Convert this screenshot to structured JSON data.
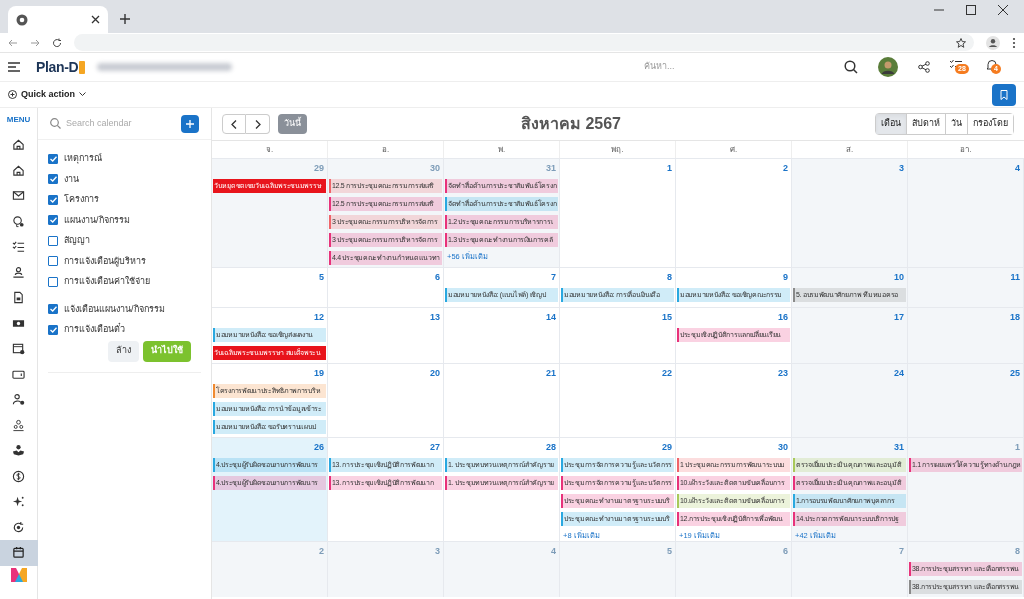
{
  "app": {
    "logo": "Plan-D",
    "search_placeholder": "ค้นหา...",
    "task_badge": "28",
    "notification_badge": "4",
    "quick_action": "Quick action"
  },
  "nav_rail": {
    "label": "MENU",
    "items": [
      {
        "selected": false
      },
      {
        "selected": false
      },
      {
        "selected": false
      },
      {
        "selected": false
      },
      {
        "selected": false
      },
      {
        "selected": false
      },
      {
        "selected": false
      },
      {
        "selected": false
      },
      {
        "selected": false
      },
      {
        "selected": false
      },
      {
        "selected": false
      },
      {
        "selected": false
      },
      {
        "selected": false
      },
      {
        "selected": false
      },
      {
        "selected": false
      },
      {
        "selected": false
      },
      {
        "selected": true
      }
    ]
  },
  "filter_panel": {
    "search_placeholder": "Search calendar",
    "groups": [
      [
        {
          "label": "เหตุการณ์",
          "checked": true
        },
        {
          "label": "งาน",
          "checked": true
        },
        {
          "label": "โครงการ",
          "checked": true
        },
        {
          "label": "แผนงาน/กิจกรรม",
          "checked": true
        },
        {
          "label": "สัญญา",
          "checked": false
        },
        {
          "label": "การแจ้งเตือนผู้บริหาร",
          "checked": false
        },
        {
          "label": "การแจ้งเตือนค่าใช้จ่าย",
          "checked": false
        }
      ],
      [
        {
          "label": "แจ้งเตือนแผนงาน/กิจกรรม",
          "checked": true
        },
        {
          "label": "การแจ้งเตือนตั๋ว",
          "checked": true
        }
      ]
    ],
    "clear_button": "ล้าง",
    "apply_button": "นำไปใช้"
  },
  "calendar": {
    "today_button": "วันนี้",
    "title": "สิงหาคม 2567",
    "views": [
      {
        "label": "เดือน",
        "selected": true
      },
      {
        "label": "สัปดาห์",
        "selected": false
      },
      {
        "label": "วัน",
        "selected": false
      },
      {
        "label": "กรองโดย",
        "selected": false
      }
    ],
    "weekdays": [
      "จ.",
      "อ.",
      "พ.",
      "พฤ.",
      "ศ.",
      "ส.",
      "อา."
    ],
    "weeks": [
      {
        "days": [
          {
            "day": "29",
            "outside": true,
            "today": false,
            "events": [
              {
                "kind": "holiday",
                "color": "#e8141c",
                "text": "วันหยุดชดเชยวันเฉลิมพระชนมพรรษ"
              }
            ]
          },
          {
            "day": "30",
            "outside": true,
            "today": false,
            "events": [
              {
                "kind": "event",
                "color": "#f0646a",
                "text": "12.5 การประชุมคณะกรรมการส่งเสริ"
              },
              {
                "kind": "event",
                "color": "#e8327a",
                "text": "12.5 การประชุมคณะกรรมการส่งเสริ"
              },
              {
                "kind": "event",
                "color": "#f0646a",
                "text": "3 ประชุมคณะกรรมการบริหารจัดการ"
              },
              {
                "kind": "event",
                "color": "#e8327a",
                "text": "3 ประชุมคณะกรรมการบริหารจัดการ"
              },
              {
                "kind": "event",
                "color": "#e8327a",
                "text": "4.4 ประชุมคณะทำงานกำหนดแนวทา"
              }
            ]
          },
          {
            "day": "31",
            "outside": true,
            "today": false,
            "events": [
              {
                "kind": "event",
                "color": "#e8327a",
                "text": "จัดทำสื่อด้านการประชาสัมพันธ์โครงก"
              },
              {
                "kind": "event",
                "color": "#29a8e0",
                "text": "จัดทำสื่อด้านการประชาสัมพันธ์โครงก"
              },
              {
                "kind": "event",
                "color": "#e8327a",
                "text": "1.2 ประชุมคณะกรรมการบริหารการเ"
              },
              {
                "kind": "event",
                "color": "#e8327a",
                "text": "1.3 ประชุมคณะทำงานการเงินการคลั"
              }
            ],
            "more": "+56 เพิ่มเติม"
          },
          {
            "day": "1",
            "outside": false,
            "today": false
          },
          {
            "day": "2",
            "outside": false,
            "today": false
          },
          {
            "day": "3",
            "outside": false,
            "today": false
          },
          {
            "day": "4",
            "outside": false,
            "today": false
          }
        ]
      },
      {
        "days": [
          {
            "day": "5",
            "outside": false,
            "today": false
          },
          {
            "day": "6",
            "outside": false,
            "today": false
          },
          {
            "day": "7",
            "outside": false,
            "today": false,
            "events": [
              {
                "kind": "event",
                "color": "#29a8e0",
                "text": "มอบหมายหนังสือ: (แบบไฟล์) เชิญป"
              }
            ]
          },
          {
            "day": "8",
            "outside": false,
            "today": false,
            "events": [
              {
                "kind": "event",
                "color": "#29a8e0",
                "text": "มอบหมายหนังสือ: การเลื่อนเงินเดือ"
              }
            ]
          },
          {
            "day": "9",
            "outside": false,
            "today": false,
            "events": [
              {
                "kind": "event",
                "color": "#29a8e0",
                "text": "มอบหมายหนังสือ: ขอเชิญคณะกรรม"
              }
            ]
          },
          {
            "day": "10",
            "outside": false,
            "today": false,
            "events": [
              {
                "kind": "event",
                "color": "#8a8a8a",
                "text": "5. อบรมพัฒนาศักยภาพ ทีมหมอครอ"
              }
            ]
          },
          {
            "day": "11",
            "outside": false,
            "today": false
          }
        ]
      },
      {
        "days": [
          {
            "day": "12",
            "outside": false,
            "today": false,
            "events": [
              {
                "kind": "event",
                "color": "#29a8e0",
                "text": "มอบหมายหนังสือ: ขอเชิญส่งผลงาน"
              },
              {
                "kind": "holiday",
                "color": "#e8141c",
                "text": "วันเฉลิมพระชนมพรรษา สมเด็จพระน"
              }
            ]
          },
          {
            "day": "13",
            "outside": false,
            "today": false
          },
          {
            "day": "14",
            "outside": false,
            "today": false
          },
          {
            "day": "15",
            "outside": false,
            "today": false
          },
          {
            "day": "16",
            "outside": false,
            "today": false,
            "events": [
              {
                "kind": "event",
                "color": "#e8327a",
                "text": "ประชุมเชิงปฏิบัติการแลกเปลี่ยนเรียน"
              }
            ]
          },
          {
            "day": "17",
            "outside": false,
            "today": false
          },
          {
            "day": "18",
            "outside": false,
            "today": false
          }
        ]
      },
      {
        "days": [
          {
            "day": "19",
            "outside": false,
            "today": false,
            "events": [
              {
                "kind": "event",
                "color": "#f08a30",
                "text": "โครงการพัฒนาประสิทธิภาพการบริห"
              },
              {
                "kind": "event",
                "color": "#29a8e0",
                "text": "มอบหมายหนังสือ: การนำข้อมูลเข้าระ"
              },
              {
                "kind": "event",
                "color": "#29a8e0",
                "text": "มอบหมายหนังสือ: ขอรับทราบแผนป"
              }
            ]
          },
          {
            "day": "20",
            "outside": false,
            "today": false
          },
          {
            "day": "21",
            "outside": false,
            "today": false
          },
          {
            "day": "22",
            "outside": false,
            "today": false
          },
          {
            "day": "23",
            "outside": false,
            "today": false
          },
          {
            "day": "24",
            "outside": false,
            "today": false
          },
          {
            "day": "25",
            "outside": false,
            "today": false
          }
        ]
      },
      {
        "days": [
          {
            "day": "26",
            "outside": false,
            "today": true,
            "events": [
              {
                "kind": "event",
                "color": "#29a8e0",
                "text": "4.ประชุมผู้รับผิดชอบงานการพัฒนาร"
              },
              {
                "kind": "event",
                "color": "#e8327a",
                "text": "4.ประชุมผู้รับผิดชอบงานการพัฒนาร"
              }
            ]
          },
          {
            "day": "27",
            "outside": false,
            "today": false,
            "events": [
              {
                "kind": "event",
                "color": "#29a8e0",
                "text": "13. การประชุมเชิงปฏิบัติการพัฒนาก"
              },
              {
                "kind": "event",
                "color": "#e8327a",
                "text": "13. การประชุมเชิงปฏิบัติการพัฒนาก"
              }
            ]
          },
          {
            "day": "28",
            "outside": false,
            "today": false,
            "events": [
              {
                "kind": "event",
                "color": "#29a8e0",
                "text": "1. ประชุมทบทวนเหตุการณ์สำคัญราย"
              },
              {
                "kind": "event",
                "color": "#e8327a",
                "text": "1. ประชุมทบทวนเหตุการณ์สำคัญราย"
              }
            ]
          },
          {
            "day": "29",
            "outside": false,
            "today": false,
            "events": [
              {
                "kind": "event",
                "color": "#29a8e0",
                "text": "ประชุมการจัดการความรู้และนวัตกรร"
              },
              {
                "kind": "event",
                "color": "#e8327a",
                "text": "ประชุมการจัดการความรู้และนวัตกรร"
              },
              {
                "kind": "event",
                "color": "#e8327a",
                "text": "ประชุมคณะทำงานมาตรฐานระบบบริ"
              },
              {
                "kind": "event",
                "color": "#29a8e0",
                "text": "ประชุมคณะทำงานมาตรฐานระบบบริ"
              }
            ],
            "more": "+8 เพิ่มเติม"
          },
          {
            "day": "30",
            "outside": false,
            "today": false,
            "events": [
              {
                "kind": "event",
                "color": "#f0646a",
                "text": "1 ประชุมคณะกรรมการพัฒนาระบบบ"
              },
              {
                "kind": "event",
                "color": "#e8327a",
                "text": "10.เฝ้าระวังและติดตามขับเคลื่อนการ"
              },
              {
                "kind": "event",
                "color": "#a8c95a",
                "text": "10.เฝ้าระวังและติดตามขับเคลื่อนการ"
              },
              {
                "kind": "event",
                "color": "#e8327a",
                "text": "12.การประชุมเชิงปฏิบัติการเพื่อพัฒน"
              }
            ],
            "more": "+19 เพิ่มเติม"
          },
          {
            "day": "31",
            "outside": false,
            "today": false,
            "events": [
              {
                "kind": "event",
                "color": "#a8c95a",
                "text": "ตรวจเยี่ยมประเมินคุณภาพและอนุมัติ"
              },
              {
                "kind": "event",
                "color": "#e8327a",
                "text": "ตรวจเยี่ยมประเมินคุณภาพและอนุมัติ"
              },
              {
                "kind": "event",
                "color": "#29a8e0",
                "text": "1.การอบรมพัฒนาศักยภาพบุคลากร"
              },
              {
                "kind": "event",
                "color": "#e8327a",
                "text": "14.ประกวดการพัฒนาระบบบริการปฐ"
              }
            ],
            "more": "+42 เพิ่มเติม"
          },
          {
            "day": "1",
            "outside": true,
            "today": false,
            "events": [
              {
                "kind": "event",
                "color": "#e8327a",
                "text": "1.1 การเผยแพร่ให้ความรู้ทางด้านกฎห"
              }
            ]
          }
        ]
      },
      {
        "days": [
          {
            "day": "2",
            "outside": true,
            "today": false
          },
          {
            "day": "3",
            "outside": true,
            "today": false
          },
          {
            "day": "4",
            "outside": true,
            "today": false
          },
          {
            "day": "5",
            "outside": true,
            "today": false
          },
          {
            "day": "6",
            "outside": true,
            "today": false
          },
          {
            "day": "7",
            "outside": true,
            "today": false
          },
          {
            "day": "8",
            "outside": true,
            "today": false,
            "events": [
              {
                "kind": "event",
                "color": "#e8327a",
                "text": "38.การประชุมสรรหา และเลือกสรรพน"
              },
              {
                "kind": "event",
                "color": "#8a8a8a",
                "text": "38.การประชุมสรรหา และเลือกสรรพน"
              }
            ]
          }
        ]
      }
    ]
  }
}
